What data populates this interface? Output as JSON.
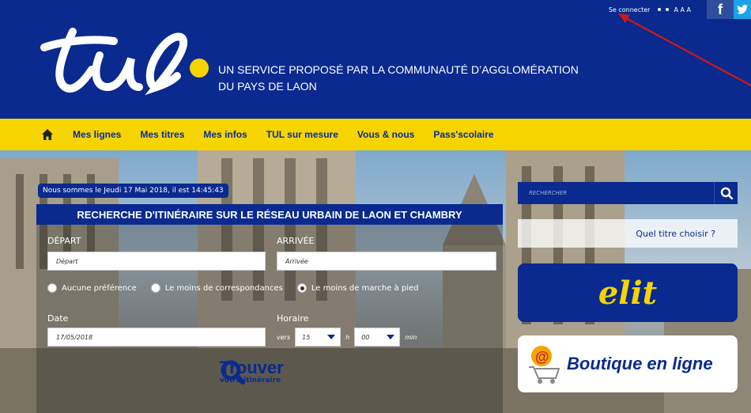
{
  "topbar": {
    "login_label": "Se connecter",
    "font_size_label": "A A A",
    "facebook_glyph": "f",
    "twitter_glyph": "🐦"
  },
  "header": {
    "logo_text": "tul",
    "tagline_line1": "UN SERVICE PROPOSÉ PAR LA COMMUNAUTÉ D’AGGLOMÉRATION",
    "tagline_line2": "DU PAYS DE LAON",
    "brand_blue": "#0a2a8f",
    "brand_yellow": "#f6d400"
  },
  "nav": {
    "home_icon": "home-icon",
    "items": [
      {
        "label": "Mes lignes"
      },
      {
        "label": "Mes titres"
      },
      {
        "label": "Mes infos"
      },
      {
        "label": "TUL sur mesure"
      },
      {
        "label": "Vous & nous"
      },
      {
        "label": "Pass'scolaire"
      }
    ]
  },
  "hero": {
    "datetime_text": "Nous sommes le Jeudi 17 Mai 2018, il est 14:45:43",
    "panel_title": "RECHERCHE D'ITINÉRAIRE SUR LE RÉSEAU URBAIN DE LAON ET CHAMBRY",
    "depart_label": "DÉPART",
    "depart_placeholder": "Départ",
    "arrivee_label": "ARRIVÉE",
    "arrivee_placeholder": "Arrivée",
    "options": [
      {
        "label": "Aucune préférence",
        "selected": false
      },
      {
        "label": "Le moins de correspondances",
        "selected": false
      },
      {
        "label": "Le moins de marche à pied",
        "selected": true
      }
    ],
    "date_label": "Date",
    "date_value": "17/05/2018",
    "horaire_label": "Horaire",
    "vers_label": "vers",
    "hour_value": "15",
    "h_label": "h",
    "minute_value": "00",
    "min_label": "min",
    "find_title": "Trouver",
    "find_subtitle": "votre itinéraire"
  },
  "sidebar": {
    "search_placeholder": "RECHERCHER",
    "quel_titre": "Quel titre choisir ?",
    "elit_text": "elit",
    "shop_text": "Boutique en ligne"
  }
}
